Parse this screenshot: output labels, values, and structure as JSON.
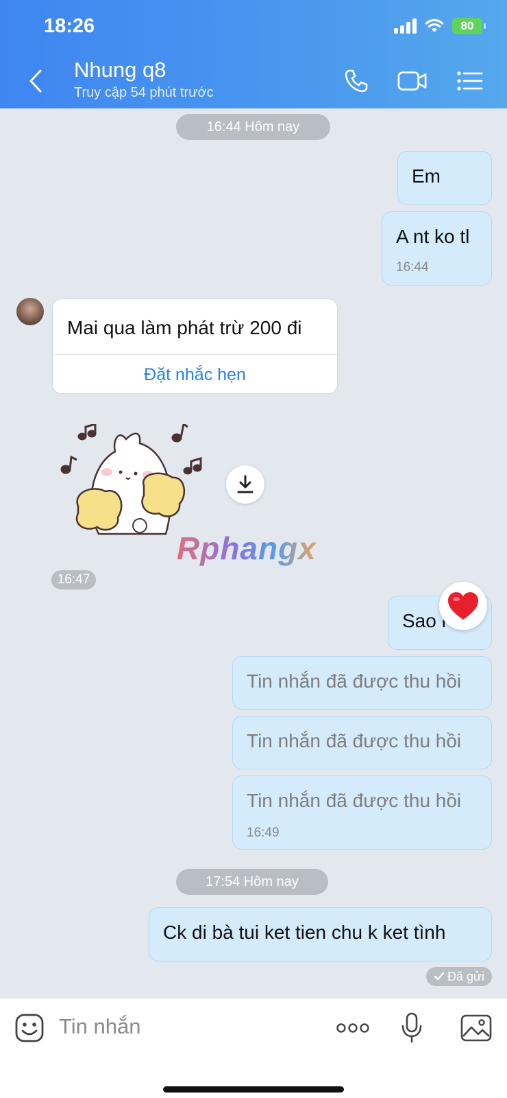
{
  "status_bar": {
    "time": "18:26",
    "battery": "80"
  },
  "header": {
    "contact_name": "Nhung q8",
    "contact_status": "Truy cập 54 phút trước"
  },
  "messages": {
    "sep1": "16:44 Hôm nay",
    "out1": {
      "text": "Em"
    },
    "out2": {
      "text": "A nt ko tl",
      "time": "16:44"
    },
    "in1": {
      "text": "Mai qua làm phát trừ 200 đi",
      "action": "Đặt nhắc hẹn"
    },
    "sticker_time": "16:47",
    "watermark": "Rphangx",
    "out3": {
      "text": "Sao r"
    },
    "recalled": [
      {
        "text": "Tin nhắn đã được thu hồi"
      },
      {
        "text": "Tin nhắn đã được thu hồi"
      },
      {
        "text": "Tin nhắn đã được thu hồi",
        "time": "16:49"
      }
    ],
    "sep2": "17:54 Hôm nay",
    "out4": {
      "text": "Ck di bà tui ket tien chu k ket tình"
    },
    "sent_status": "Đã gửi"
  },
  "input": {
    "placeholder": "Tin nhắn"
  },
  "icons": {
    "back": "chevron-left-icon",
    "call": "phone-icon",
    "video": "video-camera-icon",
    "menu": "list-menu-icon",
    "download": "download-icon",
    "reaction": "heart-icon",
    "emoji": "emoji-icon",
    "more": "more-dots-icon",
    "mic": "microphone-icon",
    "image": "image-icon",
    "check": "check-icon"
  },
  "colors": {
    "header_start": "#3f86f1",
    "header_end": "#55a8ec",
    "outgoing_bubble": "#d4ebfc",
    "link": "#2b7fe0"
  }
}
